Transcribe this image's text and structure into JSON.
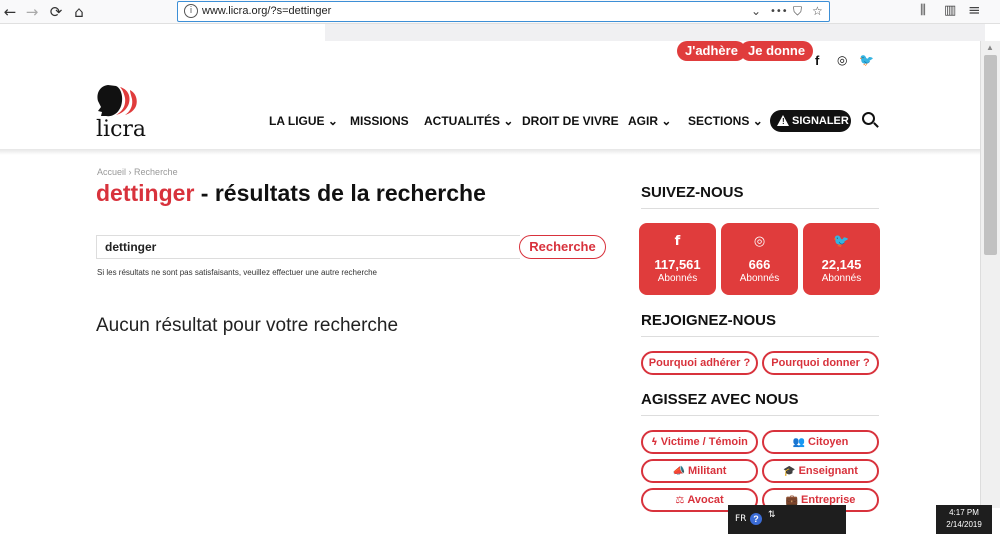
{
  "browser": {
    "url": "www.licra.org/?s=dettinger",
    "back_icon": "back-arrow-icon",
    "forward_icon": "forward-arrow-icon",
    "reload_icon": "reload-icon",
    "home_icon": "home-icon",
    "dropdown_glyph": "⌄",
    "more_glyph": "•••",
    "pocket_glyph": "⛉",
    "bookmark_glyph": "☆",
    "library_glyph": "⫼",
    "sidebar_glyph": "▥",
    "menu_glyph": "≡"
  },
  "header": {
    "adhere": "J'adhère",
    "donne": "Je donne",
    "facebook_glyph": "f",
    "instagram_glyph": "◎",
    "twitter_glyph": "🐦",
    "logo_text": "licra",
    "brand_color": "#e03c3c"
  },
  "nav": {
    "items": [
      "LA LIGUE",
      "MISSIONS",
      "ACTUALITÉS",
      "DROIT DE VIVRE",
      "AGIR",
      "SECTIONS"
    ],
    "chevron": "⌄",
    "signaler": "SIGNALER"
  },
  "content": {
    "breadcrumb_home": "Accueil",
    "breadcrumb_sep": "›",
    "breadcrumb_current": "Recherche",
    "search_term": "dettinger",
    "title_rest": " - résultats de la recherche",
    "search_value": "dettinger",
    "search_button": "Recherche",
    "hint": "Si les résultats ne sont pas satisfaisants, veuillez effectuer une autre recherche",
    "no_result": "Aucun résultat pour votre recherche"
  },
  "sidebar": {
    "follow_heading": "SUIVEZ-NOUS",
    "cards": [
      {
        "icon": "f",
        "count": "117,561",
        "label": "Abonnés"
      },
      {
        "icon": "◎",
        "count": "666",
        "label": "Abonnés"
      },
      {
        "icon": "🐦",
        "count": "22,145",
        "label": "Abonnés"
      }
    ],
    "join_heading": "REJOIGNEZ-NOUS",
    "join_buttons": [
      "Pourquoi adhérer ?",
      "Pourquoi donner ?"
    ],
    "act_heading": "AGISSEZ AVEC NOUS",
    "act_buttons": [
      {
        "icon": "ϟ",
        "label": "Victime / Témoin"
      },
      {
        "icon": "👥",
        "label": "Citoyen"
      },
      {
        "icon": "📣",
        "label": "Militant"
      },
      {
        "icon": "🎓",
        "label": "Enseignant"
      },
      {
        "icon": "⚖",
        "label": "Avocat"
      },
      {
        "icon": "💼",
        "label": "Entreprise"
      }
    ]
  },
  "taskbar": {
    "lang": "FR",
    "help": "?",
    "time": "4:17 PM",
    "date": "2/14/2019"
  }
}
